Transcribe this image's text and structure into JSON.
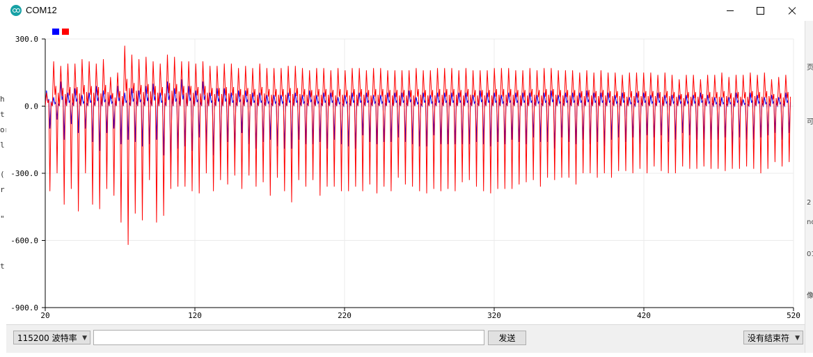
{
  "window": {
    "title": "COM12",
    "minimize_icon": "minimize-icon",
    "maximize_icon": "maximize-icon",
    "close_icon": "close-icon"
  },
  "left_edge_fragments": [
    "h",
    "t",
    "or",
    "l",
    "(",
    "r",
    "\"",
    "t"
  ],
  "right_edge_fragments": [
    "页",
    "可",
    "2",
    "no",
    "01",
    "像"
  ],
  "chart_data": {
    "type": "line",
    "x_range": [
      20,
      520
    ],
    "ylim": [
      -900,
      300
    ],
    "xticks": [
      20,
      120,
      220,
      320,
      420,
      520
    ],
    "yticks": [
      300,
      0,
      -300,
      -600,
      -900
    ],
    "xtick_labels": [
      "20",
      "120",
      "220",
      "320",
      "420",
      "520"
    ],
    "ytick_labels": [
      "300.0",
      "0.0",
      "-300.0",
      "-600.0",
      "-900.0"
    ],
    "grid": true,
    "legend_placement": "top-left",
    "colors": {
      "blue": "#0000ff",
      "red": "#ff0000",
      "grid": "#ebebeb",
      "axis": "#000000"
    },
    "cycle_period_samples": 4.75,
    "series": [
      {
        "color": "#0000ff",
        "peaks": [
          70,
          40,
          110,
          60,
          80,
          50,
          60,
          90,
          70,
          50,
          90,
          60,
          80,
          70,
          90,
          100,
          60,
          110,
          80,
          120,
          90,
          70,
          110,
          60,
          80,
          80,
          60,
          70,
          70,
          60,
          60,
          50,
          50,
          50,
          60,
          60,
          50,
          70,
          50,
          60,
          60,
          40,
          50,
          60,
          60,
          60,
          50,
          50,
          60,
          60,
          60,
          70,
          40,
          60,
          50,
          60,
          60,
          60,
          60,
          60,
          50,
          70,
          60,
          60,
          50,
          60,
          60,
          60,
          60,
          50,
          60,
          70,
          50,
          60,
          60,
          60,
          70,
          60,
          60,
          60,
          50,
          60,
          40,
          60,
          60,
          50,
          60,
          50,
          50,
          50,
          50,
          50,
          60,
          50,
          40,
          40,
          40,
          60,
          30,
          60,
          50,
          40,
          50,
          40,
          60
        ],
        "troughs": [
          -100,
          -60,
          -150,
          -80,
          -120,
          -100,
          -160,
          -200,
          -120,
          -100,
          -170,
          -150,
          -160,
          -180,
          -170,
          -150,
          -220,
          -290,
          -190,
          -180,
          -200,
          -140,
          -180,
          -220,
          -200,
          -160,
          -190,
          -120,
          -170,
          -190,
          -160,
          -150,
          -180,
          -190,
          -190,
          -150,
          -170,
          -170,
          -160,
          -190,
          -150,
          -170,
          -180,
          -190,
          -130,
          -160,
          -170,
          -160,
          -160,
          -140,
          -160,
          -170,
          -180,
          -180,
          -130,
          -170,
          -170,
          -170,
          -170,
          -170,
          -160,
          -170,
          -180,
          -160,
          -170,
          -150,
          -160,
          -170,
          -140,
          -160,
          -160,
          -190,
          -140,
          -160,
          -170,
          -150,
          -170,
          -160,
          -180,
          -150,
          -140,
          -160,
          -140,
          -170,
          -130,
          -140,
          -130,
          -160,
          -150,
          -120,
          -130,
          -150,
          -150,
          -150,
          -150,
          -140,
          -180,
          -140,
          -150,
          -150,
          -140,
          -130,
          -120,
          -150,
          -120
        ]
      },
      {
        "color": "#ff0000",
        "peaks": [
          60,
          200,
          180,
          190,
          190,
          210,
          200,
          190,
          210,
          130,
          150,
          270,
          230,
          210,
          220,
          200,
          190,
          230,
          220,
          200,
          200,
          190,
          200,
          180,
          180,
          190,
          190,
          170,
          180,
          170,
          190,
          170,
          170,
          170,
          180,
          180,
          170,
          160,
          170,
          170,
          160,
          170,
          160,
          170,
          170,
          160,
          170,
          170,
          160,
          160,
          160,
          160,
          170,
          160,
          160,
          170,
          170,
          170,
          160,
          170,
          160,
          160,
          160,
          170,
          170,
          170,
          160,
          160,
          170,
          160,
          170,
          170,
          160,
          160,
          160,
          150,
          160,
          150,
          160,
          150,
          150,
          140,
          150,
          150,
          150,
          150,
          140,
          150,
          140,
          120,
          140,
          140,
          120,
          140,
          140,
          150,
          130,
          140,
          140,
          150,
          140,
          150,
          120,
          130,
          140
        ],
        "troughs": [
          -380,
          -300,
          -440,
          -370,
          -470,
          -300,
          -440,
          -460,
          -370,
          -400,
          -520,
          -620,
          -480,
          -510,
          -330,
          -520,
          -490,
          -370,
          -360,
          -360,
          -380,
          -390,
          -300,
          -380,
          -330,
          -350,
          -310,
          -370,
          -310,
          -360,
          -340,
          -400,
          -320,
          -380,
          -430,
          -330,
          -360,
          -330,
          -400,
          -360,
          -360,
          -380,
          -380,
          -360,
          -380,
          -350,
          -390,
          -360,
          -380,
          -320,
          -350,
          -360,
          -380,
          -390,
          -370,
          -380,
          -370,
          -380,
          -340,
          -330,
          -360,
          -380,
          -390,
          -370,
          -370,
          -370,
          -350,
          -340,
          -330,
          -360,
          -320,
          -330,
          -320,
          -320,
          -350,
          -300,
          -300,
          -320,
          -300,
          -320,
          -290,
          -290,
          -300,
          -280,
          -300,
          -270,
          -290,
          -300,
          -300,
          -270,
          -280,
          -280,
          -270,
          -280,
          -280,
          -290,
          -280,
          -280,
          -270,
          -280,
          -300,
          -280,
          -250,
          -270,
          -250
        ]
      }
    ]
  },
  "bottom": {
    "baud_label": "115200 波特率",
    "input_value": "",
    "send_label": "发送",
    "line_ending_label": "没有结束符"
  }
}
